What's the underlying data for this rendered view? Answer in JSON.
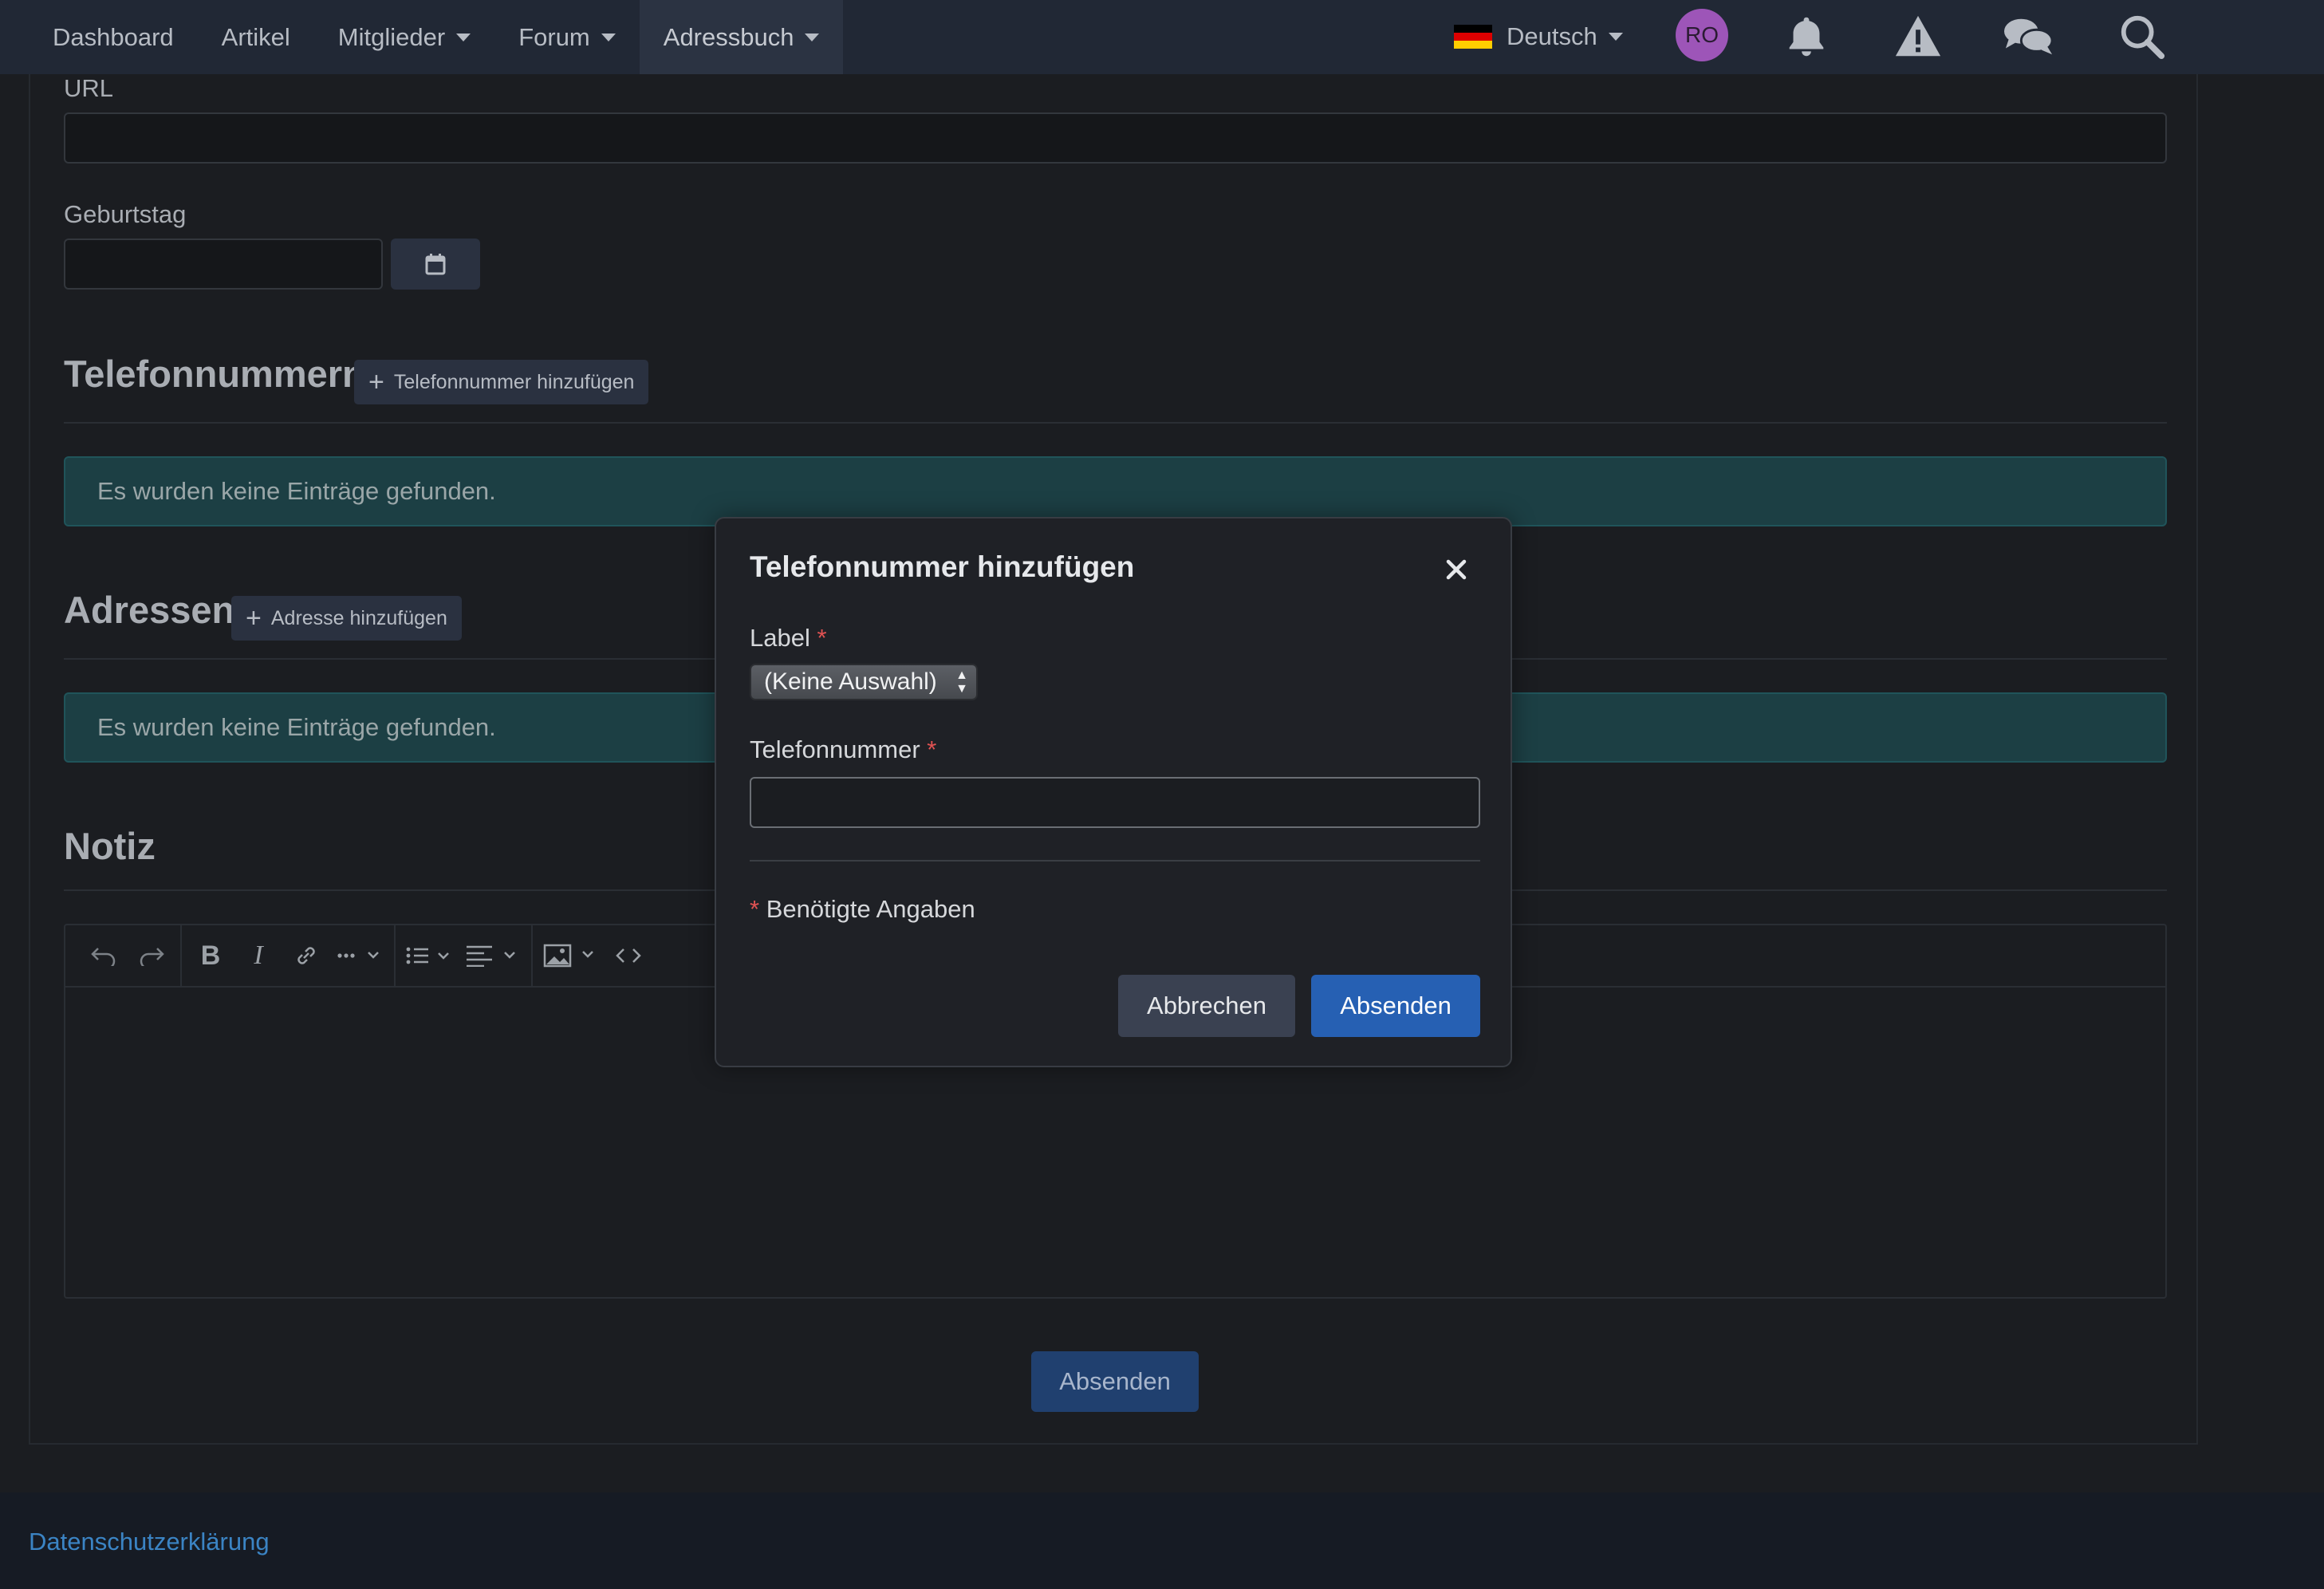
{
  "nav": {
    "items": [
      {
        "label": "Dashboard"
      },
      {
        "label": "Artikel"
      },
      {
        "label": "Mitglieder"
      },
      {
        "label": "Forum"
      },
      {
        "label": "Adressbuch"
      }
    ],
    "language": "Deutsch",
    "avatar_initials": "RO",
    "flag_colors": [
      "#000000",
      "#dd0000",
      "#ffce00"
    ]
  },
  "form": {
    "url_label": "URL",
    "birthday_label": "Geburtstag",
    "phones_title": "Telefonnummern",
    "add_phone_label": "Telefonnummer hinzufügen",
    "phones_empty": "Es wurden keine Einträge gefunden.",
    "addresses_title": "Adressen",
    "add_address_label": "Adresse hinzufügen",
    "addresses_empty": "Es wurden keine Einträge gefunden.",
    "note_title": "Notiz",
    "submit_label": "Absenden"
  },
  "footer": {
    "privacy_link": "Datenschutzerklärung"
  },
  "modal": {
    "title": "Telefonnummer hinzufügen",
    "label_field": "Label",
    "label_value": "(Keine Auswahl)",
    "phone_field": "Telefonnummer",
    "phone_value": "",
    "required_marker": "*",
    "required_note": "Benötigte Angaben",
    "cancel_label": "Abbrechen",
    "submit_label": "Absenden"
  },
  "colors": {
    "accent_blue": "#2660b3",
    "alert_teal": "#1c3f44",
    "required_red": "#e05252"
  }
}
